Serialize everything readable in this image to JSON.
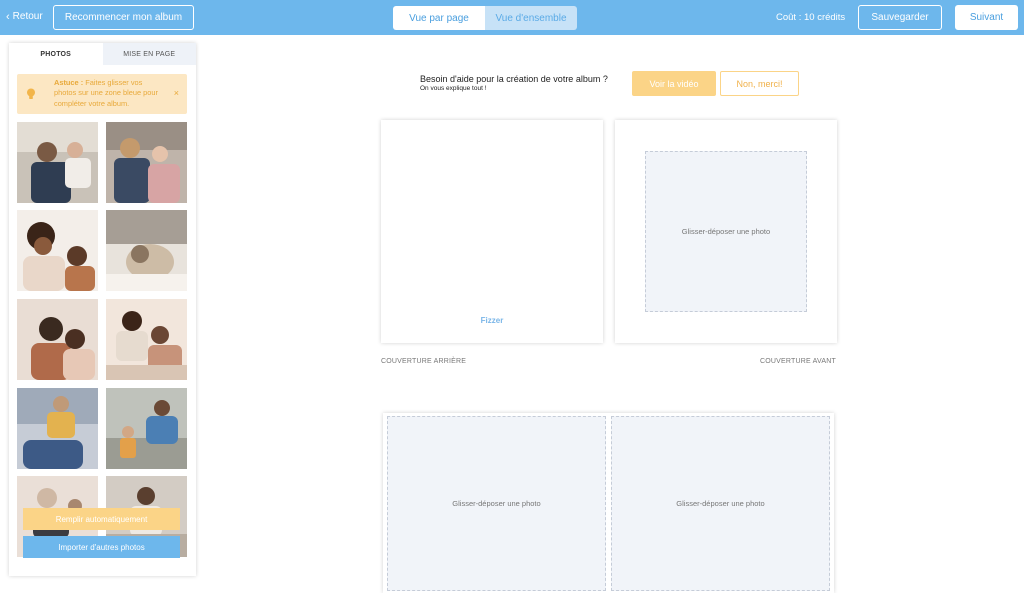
{
  "topbar": {
    "back_label": "Retour",
    "restart_label": "Recommencer mon album",
    "views": [
      "Vue par page",
      "Vue d'ensemble"
    ],
    "cost": "Coût : 10 crédits",
    "save_label": "Sauvegarder",
    "next_label": "Suivant"
  },
  "sidebar": {
    "tabs": [
      "PHOTOS",
      "MISE EN PAGE"
    ],
    "tip": {
      "strong": "Astuce :",
      "text": " Faites glisser vos photos sur une zone bleue pour compléter votre album.",
      "close": "×"
    },
    "autofill_label": "Remplir automatiquement",
    "import_label": "Importer d'autres photos"
  },
  "help": {
    "title": "Besoin d'aide pour la création de votre album ?",
    "subtitle": "On vous explique tout !",
    "video_label": "Voir la vidéo",
    "no_label": "Non, merci!"
  },
  "covers": {
    "brand": "Fizzer",
    "drop_text": "Glisser-déposer une photo",
    "back_label": "COUVERTURE ARRIÈRE",
    "front_label": "COUVERTURE AVANT"
  },
  "spread": {
    "left_drop": "Glisser-déposer une photo",
    "right_drop": "Glisser-déposer une photo"
  },
  "colors": {
    "topbar": "#6db7ec",
    "accent_yellow": "#fbd487",
    "tip_bg": "#fce7c3",
    "dropzone": "#f1f4f9"
  }
}
